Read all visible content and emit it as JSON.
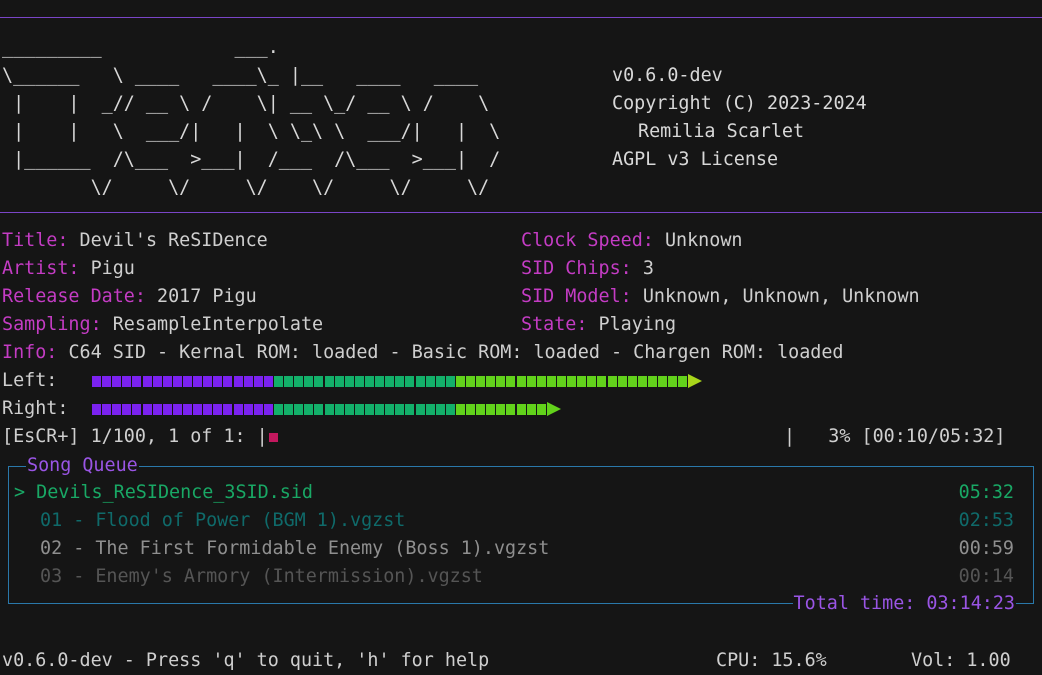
{
  "banner": {
    "ascii_lines": [
      "_________            ___.",
      "\\______   \\ ____   ____\\_ |__   ____   ____",
      " |    |  _// __ \\ /    \\| __ \\_/ __ \\ /    \\",
      " |    |   \\  ___/|   |  \\ \\_\\ \\  ___/|   |  \\",
      " |______  /\\___  >___|  /___  /\\___  >___|  /",
      "        \\/     \\/     \\/    \\/     \\/     \\/"
    ],
    "version": "v0.6.0-dev",
    "copyright": "Copyright (C) 2023-2024",
    "author": "Remilia Scarlet",
    "license": "AGPL v3 License"
  },
  "track": {
    "title_label": "Title:",
    "title": "Devil's ReSIDence",
    "artist_label": "Artist:",
    "artist": "Pigu",
    "release_label": "Release Date:",
    "release": "2017 Pigu",
    "sampling_label": "Sampling:",
    "sampling": "ResampleInterpolate",
    "clock_label": "Clock Speed:",
    "clock": "Unknown",
    "chips_label": "SID Chips:",
    "chips": "3",
    "model_label": "SID Model:",
    "model": "Unknown, Unknown, Unknown",
    "state_label": "State:",
    "state": "Playing",
    "info_label": "Info:",
    "info": "C64 SID - Kernal ROM: loaded - Basic ROM: loaded - Chargen ROM: loaded"
  },
  "meters": {
    "left_label": "Left:",
    "right_label": "Right:",
    "left_level": 0.54,
    "right_level": 0.41
  },
  "progress": {
    "prefix": "[EsCR+] 1/100, 1 of 1: |",
    "suffix": "|   3% [00:10/05:32]",
    "fraction": 0.03
  },
  "queue": {
    "title": "Song Queue",
    "items": [
      {
        "marker": ">",
        "name": "Devils_ReSIDence_3SID.sid",
        "duration": "05:32"
      },
      {
        "marker": "",
        "name": "01 - Flood of Power (BGM 1).vgzst",
        "duration": "02:53"
      },
      {
        "marker": "",
        "name": "02 - The First Formidable Enemy (Boss 1).vgzst",
        "duration": "00:59"
      },
      {
        "marker": "",
        "name": "03 - Enemy's Armory (Intermission).vgzst",
        "duration": "00:14"
      }
    ],
    "total": "Total time: 03:14:23"
  },
  "status_bar": {
    "help": "v0.6.0-dev - Press 'q' to quit, 'h' for help",
    "cpu": "CPU: 15.6%",
    "vol": "Vol: 1.00"
  },
  "colors": {
    "label": "#c43cc4",
    "accent_purple": "#7a45c7",
    "meter_purple": "#7b22f0",
    "meter_green": "#13b06a",
    "meter_lime": "#62d21b",
    "progress_mark": "#c3185e",
    "queue_border": "#2a78aa",
    "queue_active": "#19a865"
  }
}
